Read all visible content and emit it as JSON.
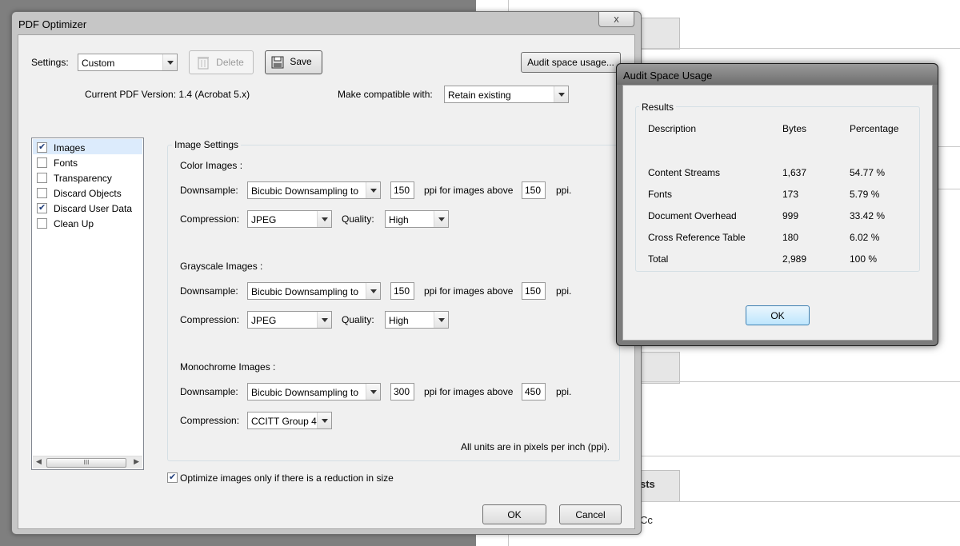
{
  "main_window": {
    "title": "PDF Optimizer",
    "close_glyph": "x",
    "settings_label": "Settings:",
    "settings_value": "Custom",
    "delete_label": "Delete",
    "save_label": "Save",
    "audit_button_label": "Audit space usage...",
    "version_text": "Current PDF Version: 1.4 (Acrobat 5.x)",
    "compat_label": "Make compatible with:",
    "compat_value": "Retain existing",
    "panels": [
      {
        "label": "Images",
        "checked": true
      },
      {
        "label": "Fonts",
        "checked": false
      },
      {
        "label": "Transparency",
        "checked": false
      },
      {
        "label": "Discard Objects",
        "checked": false
      },
      {
        "label": "Discard User Data",
        "checked": true
      },
      {
        "label": "Clean Up",
        "checked": false
      }
    ],
    "scroll_thumb": "III",
    "image_settings": {
      "group_title": "Image Settings",
      "downsample_label": "Downsample:",
      "compression_label": "Compression:",
      "quality_label": "Quality:",
      "ppi_above": "ppi for images above",
      "ppi": "ppi.",
      "color": {
        "title": "Color Images :",
        "method": "Bicubic Downsampling to",
        "ppi_value": "150",
        "above_value": "150",
        "compression": "JPEG",
        "quality": "High"
      },
      "grayscale": {
        "title": "Grayscale Images :",
        "method": "Bicubic Downsampling to",
        "ppi_value": "150",
        "above_value": "150",
        "compression": "JPEG",
        "quality": "High"
      },
      "mono": {
        "title": "Monochrome Images :",
        "method": "Bicubic Downsampling to",
        "ppi_value": "300",
        "above_value": "450",
        "compression": "CCITT Group 4"
      },
      "units_note": "All units are in pixels per inch (ppi)."
    },
    "optimize_only_label": "Optimize images only if there is a reduction in size",
    "optimize_only_checked": true,
    "ok_label": "OK",
    "cancel_label": "Cancel"
  },
  "audit_window": {
    "title": "Audit Space Usage",
    "group_title": "Results",
    "headers": [
      "Description",
      "Bytes",
      "Percentage"
    ],
    "rows": [
      {
        "description": "Content Streams",
        "bytes": "1,637",
        "percentage": "54.77 %"
      },
      {
        "description": "Fonts",
        "bytes": "173",
        "percentage": "5.79 %"
      },
      {
        "description": "Document Overhead",
        "bytes": "999",
        "percentage": "33.42 %"
      },
      {
        "description": "Cross Reference Table",
        "bytes": "180",
        "percentage": "6.02 %"
      },
      {
        "description": "Total",
        "bytes": "2,989",
        "percentage": "100 %"
      }
    ],
    "ok_label": "OK"
  },
  "background": {
    "fragment_1": "sts",
    "fragment_2": "Cc"
  },
  "colors": {
    "accent_border": "#3c7fb1",
    "check_mark": "#1e3c7a"
  }
}
